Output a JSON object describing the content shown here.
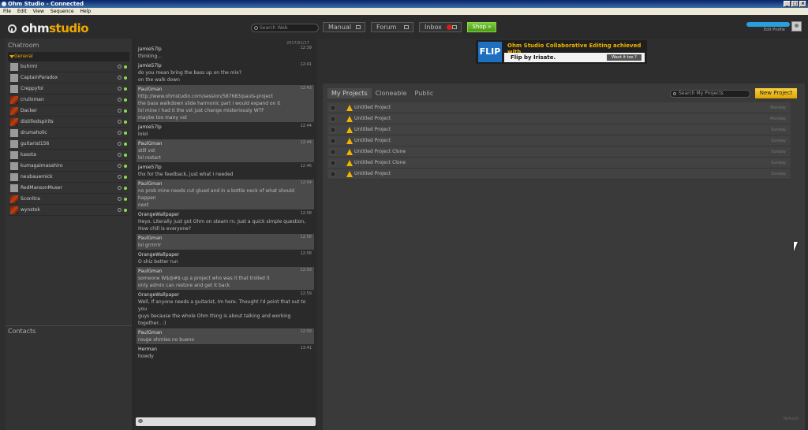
{
  "window": {
    "title": "Ohm Studio - Connected"
  },
  "menu": [
    "File",
    "Edit",
    "View",
    "Sequence",
    "Help"
  ],
  "header": {
    "logo_plain": "ohm",
    "logo_bold": "studio",
    "search_placeholder": "Search Web",
    "manual": "Manual",
    "forum": "Forum",
    "inbox": "Inbox",
    "shop": "Shop »",
    "edit_profile": "Edit Profile"
  },
  "chatroom": {
    "title": "Chatroom",
    "group": "General",
    "users": [
      "buhrmi",
      "CaptainParadox",
      "Creppyfol",
      "cruilxman",
      "Dacker",
      "distilledspirits",
      "drumaholic",
      "guitarist156",
      "kasota",
      "kumagaimasahiro",
      "neubauemick",
      "RedMansonMuser",
      "Sconitra",
      "wynstok"
    ],
    "contacts": "Contacts"
  },
  "chat": {
    "date": "2017/01/17",
    "messages": [
      {
        "author": "jamie57lp",
        "time": "12:39",
        "text": [
          "thinking..."
        ]
      },
      {
        "author": "jamie57lp",
        "time": "12:41",
        "text": [
          "do you mean bring the bass up on the mix?",
          "on the walk down"
        ]
      },
      {
        "author": "PaulGman",
        "time": "12:43",
        "text": [
          "http://www.ohmstudio.com/session/587683/pauls-project",
          "the bass walkdown slide harmonic part I would expand on it",
          "lol mine I had it the vst just change misteriously WTF",
          "maybe too many vst"
        ]
      },
      {
        "author": "jamie57lp",
        "time": "12:44",
        "text": [
          "lolol"
        ]
      },
      {
        "author": "PaulGman",
        "time": "12:44",
        "text": [
          "still vst",
          "lol restart"
        ]
      },
      {
        "author": "jamie57lp",
        "time": "12:46",
        "text": [
          "thx for the feedback, just what I needed"
        ]
      },
      {
        "author": "PaulGman",
        "time": "12:54",
        "text": [
          "no prob mine needs cut glued and in a bottle neck of what should happen",
          "next"
        ]
      },
      {
        "author": "OrangeWallpaper",
        "time": "12:58",
        "text": [
          "Heyo. Literally just got Ohm on steam rn. Just a quick simple question,",
          "How chill is everyone?"
        ]
      },
      {
        "author": "PaulGman",
        "time": "12:58",
        "text": [
          "lol grrrrrrr"
        ]
      },
      {
        "author": "OrangeWallpaper",
        "time": "12:58",
        "text": [
          "O shiz better run"
        ]
      },
      {
        "author": "PaulGman",
        "time": "12:59",
        "text": [
          "someone W$@#$ up a project who was it that trolled it",
          "only admin can restore and get it back"
        ]
      },
      {
        "author": "OrangeWallpaper",
        "time": "12:59",
        "text": [
          "Well, If anyone needs a guitarist, Im here. Thought i'd point that out to you",
          "guys because the whole Ohm thing is about talking and working",
          "together.. :)"
        ]
      },
      {
        "author": "PaulGman",
        "time": "12:59",
        "text": [
          "rouge ohmies no bueno"
        ]
      },
      {
        "author": "Herman",
        "time": "13:41",
        "text": [
          "howdy"
        ]
      }
    ]
  },
  "banner": {
    "logo": "FLIP",
    "line1": "Ohm Studio Collaborative Editing achieved with",
    "line2": "Flip by Irisate.",
    "button": "Want it too ?"
  },
  "projects": {
    "tabs": [
      "My Projects",
      "Cloneable",
      "Public"
    ],
    "search_placeholder": "Search My Projects",
    "new_button": "New Project",
    "rows": [
      {
        "name": "Untitled Project",
        "day": "Monday"
      },
      {
        "name": "Untitled Project",
        "day": "Monday"
      },
      {
        "name": "Untitled Project",
        "day": "Sunday"
      },
      {
        "name": "Untitled Project",
        "day": "Sunday"
      },
      {
        "name": "Untitled Project Clone",
        "day": "Sunday"
      },
      {
        "name": "Untitled Project Clone",
        "day": "Sunday"
      },
      {
        "name": "Untitled Project",
        "day": "Sunday"
      }
    ],
    "refresh": "Refresh"
  }
}
